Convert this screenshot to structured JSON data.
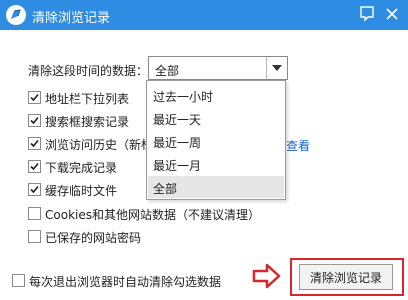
{
  "window": {
    "title": "清除浏览记录",
    "title_color": "#2f8ce3"
  },
  "time_range": {
    "label": "清除这段时间的数据：",
    "selected": "全部",
    "options": [
      "过去一小时",
      "最近一天",
      "最近一周",
      "最近一月",
      "全部"
    ]
  },
  "items": [
    {
      "label": "地址栏下拉列表",
      "checked": true
    },
    {
      "label": "搜索框搜索记录",
      "checked": true
    },
    {
      "label": "浏览访问历史（新标",
      "checked": true
    },
    {
      "label": "下载完成记录",
      "checked": true
    },
    {
      "label": "缓存临时文件",
      "checked": true
    },
    {
      "label": "Cookies和其他网站数据（不建议清理）",
      "checked": false
    },
    {
      "label": "已保存的网站密码",
      "checked": false
    }
  ],
  "view_link": "查看",
  "footer": {
    "auto_clear_label": "每次退出浏览器时自动清除勾选数据",
    "auto_clear_checked": false,
    "clear_button_label": "清除浏览记录"
  },
  "icons": {
    "app": "browser-logo-icon",
    "help": "help-icon",
    "close": "close-icon",
    "dropdown": "chevron-down-icon",
    "pointer": "right-arrow-icon"
  },
  "colors": {
    "accent": "#2f8ce3",
    "highlight": "#d8262d",
    "link": "#1a66c9"
  }
}
